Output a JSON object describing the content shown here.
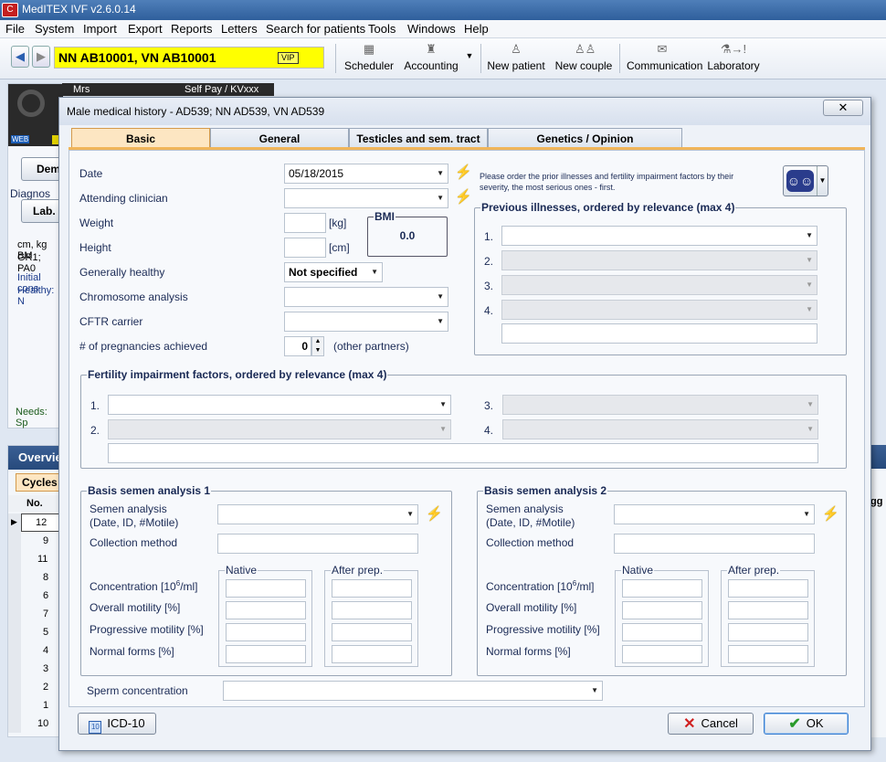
{
  "app": {
    "title": "MedITEX IVF v2.6.0.14",
    "logo": "C"
  },
  "menu": [
    "File",
    "System",
    "Import",
    "Export",
    "Reports",
    "Letters",
    "Search for patients",
    "Tools",
    "Windows",
    "Help"
  ],
  "patient": {
    "name": "NN AB10001, VN AB10001",
    "vip": "VIP"
  },
  "toolbar": {
    "scheduler": "Scheduler",
    "accounting": "Accounting",
    "new_patient": "New patient",
    "new_couple": "New couple",
    "communication": "Communication",
    "laboratory": "Laboratory"
  },
  "background": {
    "mrs": "Mrs",
    "payer": "Self Pay / KVxxx",
    "web": "WEB",
    "dem": "Dem",
    "diagnos": "Diagnos",
    "lab": "Lab.",
    "cm": "cm, kg BM",
    "gr": "GR1; PA0",
    "initial": "Initial cons",
    "healthy": "Healthy: N",
    "needs": "Needs: Sp",
    "overview": "Overvie",
    "cycles": "Cycles",
    "no": "No.",
    "rows": [
      "12",
      "9",
      "11",
      "8",
      "6",
      "7",
      "5",
      "4",
      "3",
      "2",
      "1",
      "10"
    ],
    "trig": "igg"
  },
  "dialog": {
    "title": "Male medical history - AD539; NN AD539, VN AD539",
    "close": "✕",
    "tabs": [
      "Basic",
      "General",
      "Testicles and sem. tract",
      "Genetics / Opinion"
    ],
    "fields": {
      "date_label": "Date",
      "date_value": "05/18/2015",
      "attending_label": "Attending clinician",
      "weight_label": "Weight",
      "weight_unit": "[kg]",
      "height_label": "Height",
      "height_unit": "[cm]",
      "bmi_label": "BMI",
      "bmi_value": "0.0",
      "healthy_label": "Generally healthy",
      "healthy_value": "Not specified",
      "chromosome_label": "Chromosome analysis",
      "cftr_label": "CFTR carrier",
      "pregnancies_label": "# of pregnancies achieved",
      "pregnancies_value": "0",
      "pregnancies_note": "(other partners)"
    },
    "illness_hint": "Please order the prior illnesses and fertility impairment factors by their severity, the most serious ones - first.",
    "prev_illnesses": {
      "title": "Previous illnesses, ordered by relevance (max 4)",
      "numbers": [
        "1.",
        "2.",
        "3.",
        "4."
      ]
    },
    "fertility": {
      "title": "Fertility impairment factors, ordered by relevance (max 4)",
      "numbers": [
        "1.",
        "2.",
        "3.",
        "4."
      ]
    },
    "semen1": {
      "title": "Basis semen analysis 1"
    },
    "semen2": {
      "title": "Basis semen analysis 2"
    },
    "semen_labels": {
      "analysis": "Semen analysis",
      "analysis_sub": "(Date, ID, #Motile)",
      "collection": "Collection method",
      "native": "Native",
      "after_prep": "After prep.",
      "concentration": "Concentration [10",
      "concentration_sup": "6",
      "concentration_end": "/ml]",
      "overall": "Overall motility [%]",
      "progressive": "Progressive motility [%]",
      "normal": "Normal forms [%]"
    },
    "sperm_concentration": "Sperm concentration",
    "icd": "ICD-10",
    "cancel": "Cancel",
    "ok": "OK"
  }
}
